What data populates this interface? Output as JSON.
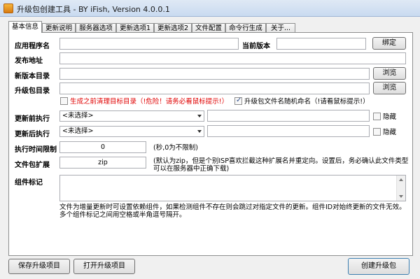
{
  "window": {
    "title": "升级包创建工具 - BY iFish, Version 4.0.0.1"
  },
  "tabs": [
    {
      "label": "基本信息"
    },
    {
      "label": "更新说明"
    },
    {
      "label": "服务器选项"
    },
    {
      "label": "更新选项1"
    },
    {
      "label": "更新选项2"
    },
    {
      "label": "文件配置"
    },
    {
      "label": "命令行生成"
    },
    {
      "label": "关于..."
    }
  ],
  "form": {
    "app_name_label": "应用程序名",
    "app_name_value": "",
    "current_version_label": "当前版本",
    "current_version_value": "",
    "bind_button": "绑定",
    "publish_url_label": "发布地址",
    "publish_url_value": "",
    "new_version_dir_label": "新版本目录",
    "new_version_dir_value": "",
    "browse_button": "浏览",
    "package_dir_label": "升级包目录",
    "package_dir_value": "",
    "clean_target_checkbox": "生成之前清理目标目录（!危险！请务必看鼠标提示!）",
    "clean_target_checked": false,
    "random_name_checkbox": "升级包文件名随机命名（!请看鼠标提示!）",
    "random_name_checked": true,
    "pre_exec_label": "更新前执行",
    "pre_exec_select": "<未选择>",
    "pre_exec_args": "",
    "pre_exec_hide": "隐藏",
    "pre_exec_hide_checked": false,
    "post_exec_label": "更新后执行",
    "post_exec_select": "<未选择>",
    "post_exec_args": "",
    "post_exec_hide": "隐藏",
    "post_exec_hide_checked": false,
    "timeout_label": "执行时间限制",
    "timeout_value": "0",
    "timeout_hint": "(秒,0为不限制)",
    "ext_label": "文件包扩展",
    "ext_value": "zip",
    "ext_hint": "(默认为zip，但是个别ISP喜欢拦截这种扩展名并重定向。设置后，务必确认此文件类型可以在服务器中正确下载)",
    "component_label": "组件标记",
    "component_value": "",
    "component_hint": "文件为增量更新时可设置依赖组件，如果检测组件不存在则会跳过对指定文件的更新。组件ID对始终更新的文件无效。多个组件标记之间用空格或半角逗号隔开。"
  },
  "footer": {
    "save_button": "保存升级项目",
    "open_button": "打开升级项目",
    "create_button": "创建升级包"
  },
  "colors": {
    "warning_text": "#e00000",
    "accent": "#2a4a88"
  }
}
